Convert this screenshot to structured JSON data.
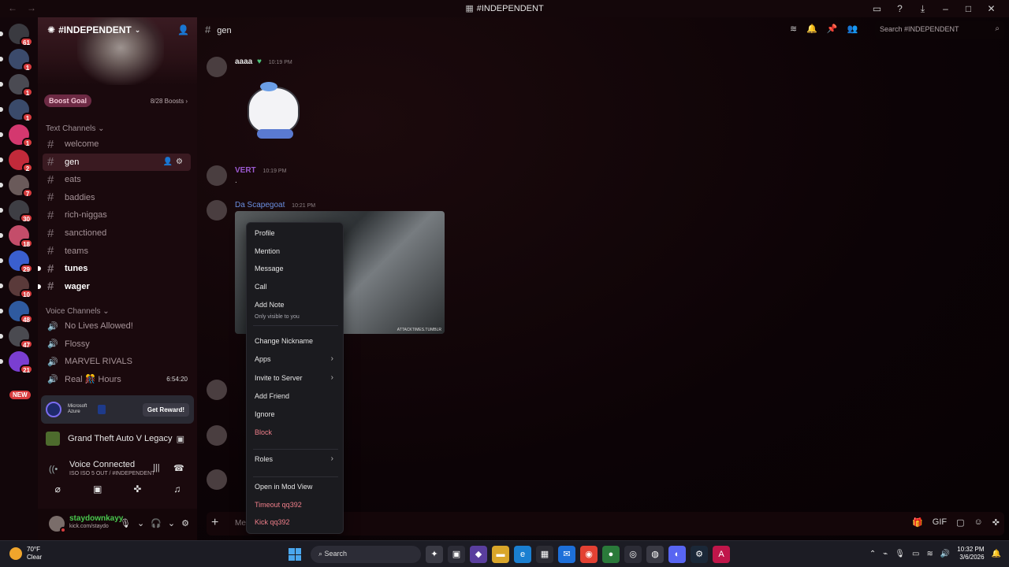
{
  "window": {
    "title": "#INDEPENDENT"
  },
  "server": {
    "name": "#INDEPENDENT",
    "boost_goal": "Boost Goal",
    "boost_count": "8/28 Boosts"
  },
  "server_rail": [
    {
      "badge": "61",
      "color": "#3a3a40"
    },
    {
      "badge": "1",
      "color": "#3b4a6b"
    },
    {
      "badge": "1",
      "color": "#4a4a52"
    },
    {
      "badge": "1",
      "color": "#3a4a6a"
    },
    {
      "badge": "1",
      "color": "#d4386f"
    },
    {
      "badge": "2",
      "color": "#c22a3a"
    },
    {
      "badge": "7",
      "color": "#6a5a5a"
    },
    {
      "badge": "30",
      "color": "#3e3e44"
    },
    {
      "badge": "18",
      "color": "#c44d6a"
    },
    {
      "badge": "29",
      "color": "#3a5fcf"
    },
    {
      "badge": "10",
      "color": "#5a3a3a"
    },
    {
      "badge": "48",
      "color": "#2f5a9f"
    },
    {
      "badge": "47",
      "color": "#4a4a50"
    },
    {
      "badge": "21",
      "color": "#7a3ed1"
    }
  ],
  "new_tag": "NEW",
  "categories": {
    "text": "Text Channels",
    "voice": "Voice Channels"
  },
  "text_channels": [
    {
      "name": "welcome"
    },
    {
      "name": "gen"
    },
    {
      "name": "eats"
    },
    {
      "name": "baddies"
    },
    {
      "name": "rich-niggas"
    },
    {
      "name": "sanctioned"
    },
    {
      "name": "teams"
    },
    {
      "name": "tunes"
    },
    {
      "name": "wager"
    }
  ],
  "voice_channels": [
    {
      "name": "No Lives Allowed!"
    },
    {
      "name": "Flossy"
    },
    {
      "name": "MARVEL RIVALS"
    },
    {
      "name": "Real 🎊 Hours",
      "time": "6:54:20"
    }
  ],
  "promo": {
    "brand": "Microsoft Azure",
    "button": "Get Reward!"
  },
  "activity": {
    "game": "Grand Theft Auto V Legacy"
  },
  "voice": {
    "status": "Voice Connected",
    "channel": "ISO ISO 5 OUT / #INDEPENDENT"
  },
  "user": {
    "name": "staydownkayy",
    "status": "kick.com/staydo"
  },
  "channel": {
    "name": "gen",
    "search_placeholder": "Search #INDEPENDENT"
  },
  "messages": [
    {
      "author": "aaaa",
      "time": "10:19 PM",
      "color": "#e6e6e6"
    },
    {
      "author": "VERT",
      "time": "10:19 PM",
      "color": "#9b59d0",
      "text": "."
    },
    {
      "author": "Da Scapegoat",
      "time": "10:21 PM",
      "color": "#6a8fe0"
    }
  ],
  "embed": {
    "credit": "ATTACKTIMES.TUMBLR"
  },
  "composer": {
    "placeholder": "Me"
  },
  "context_menu": {
    "items": [
      "Profile",
      "Mention",
      "Message",
      "Call",
      "Add Note",
      "Change Nickname",
      "Apps",
      "Invite to Server",
      "Add Friend",
      "Ignore",
      "Block",
      "Roles",
      "Open in Mod View",
      "Timeout qq392",
      "Kick qq392"
    ],
    "add_note_sub": "Only visible to you"
  },
  "taskbar": {
    "temp": "70°F",
    "weather": "Clear",
    "search": "Search",
    "time": "10:32 PM",
    "date": "3/6/2026"
  }
}
